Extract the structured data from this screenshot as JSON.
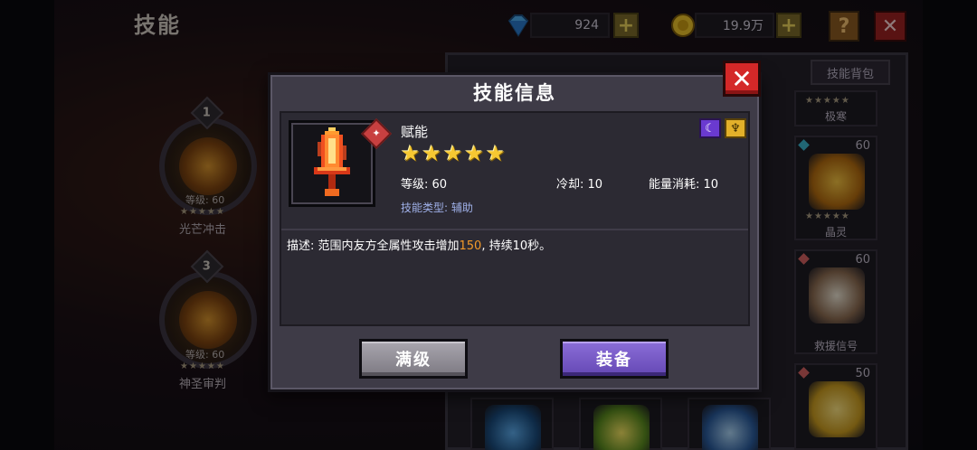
{
  "page": {
    "title": "技能"
  },
  "currency": {
    "gems": "924",
    "gold": "19.9万",
    "gem_icon": "diamond-icon",
    "gold_icon": "coin-icon",
    "plus_glyph": "+",
    "help_glyph": "?",
    "close_glyph": "✕"
  },
  "left_slots": [
    {
      "number": "1",
      "level": "等级: 60",
      "stars": "★★★★★",
      "name": "光芒冲击"
    },
    {
      "number": "3",
      "level": "等级: 60",
      "stars": "★★★★★",
      "name": "神圣审判"
    }
  ],
  "right_panel": {
    "tab_bag": "技能背包",
    "cards": [
      {
        "level": "",
        "stars": "★★★★★",
        "name": "极寒"
      },
      {
        "level": "60",
        "stars": "★★★★★",
        "name": "晶灵"
      },
      {
        "level": "60",
        "stars": "",
        "name": "救援信号"
      },
      {
        "level": "50",
        "stars": "",
        "name": ""
      }
    ]
  },
  "modal": {
    "title": "技能信息",
    "close_glyph": "✕",
    "skill_name": "赋能",
    "star_count": 5,
    "star_glyph": "★",
    "level": "等级: 60",
    "cooldown": "冷却: 10",
    "energy_cost": "能量消耗: 10",
    "skill_type": "技能类型: 辅助",
    "description_prefix": "描述: 范围内友方全属性攻击增加",
    "description_value": "150",
    "description_suffix": ", 持续10秒。",
    "tag_icons": [
      "moon-tag-icon",
      "crest-tag-icon"
    ],
    "fire_badge": "fire-element-icon"
  },
  "buttons": {
    "max_level": "满级",
    "equip": "装备"
  },
  "colors": {
    "accent_purple": "#6448b4",
    "close_red": "#d42828",
    "highlight_orange": "#f39a2a",
    "star_gold": "#f6c832",
    "type_blue": "#9fb0e8"
  }
}
